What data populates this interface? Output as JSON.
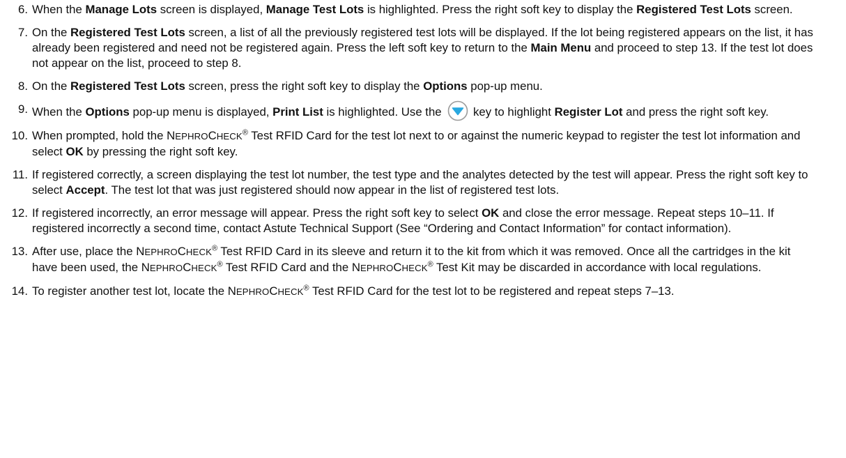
{
  "steps": [
    {
      "number": "6.",
      "parts": [
        {
          "t": "When the "
        },
        {
          "t": "Manage Lots",
          "b": true
        },
        {
          "t": " screen is displayed, "
        },
        {
          "t": "Manage Test Lots",
          "b": true
        },
        {
          "t": " is highlighted. Press the right soft key to display the "
        },
        {
          "t": "Registered Test Lots",
          "b": true
        },
        {
          "t": " screen."
        }
      ]
    },
    {
      "number": "7.",
      "parts": [
        {
          "t": "On the "
        },
        {
          "t": "Registered Test Lots",
          "b": true
        },
        {
          "t": " screen, a list of all the previously registered test lots will be displayed. If the lot being registered appears on the list, it has already been registered and need not be registered again. Press the left soft key to return to the "
        },
        {
          "t": "Main Menu",
          "b": true
        },
        {
          "t": " and proceed to step 13. If the test lot does not appear on the list, proceed to step 8."
        }
      ]
    },
    {
      "number": "8.",
      "parts": [
        {
          "t": "On the "
        },
        {
          "t": "Registered Test Lots",
          "b": true
        },
        {
          "t": " screen, press the right soft key to display the "
        },
        {
          "t": "Options",
          "b": true
        },
        {
          "t": " pop-up menu."
        }
      ]
    },
    {
      "number": "9.",
      "parts": [
        {
          "t": "When the "
        },
        {
          "t": "Options",
          "b": true
        },
        {
          "t": " pop-up menu is displayed, "
        },
        {
          "t": "Print List",
          "b": true
        },
        {
          "t": " is highlighted. Use the "
        },
        {
          "icon": "down-arrow-key-icon"
        },
        {
          "t": " key to highlight "
        },
        {
          "t": "Register Lot",
          "b": true
        },
        {
          "t": " and press the right soft key."
        }
      ]
    },
    {
      "number": "10.",
      "parts": [
        {
          "t": "When prompted, hold the "
        },
        {
          "t": "N"
        },
        {
          "t": "EPHRO",
          "sc": true
        },
        {
          "t": "C"
        },
        {
          "t": "HECK",
          "sc": true
        },
        {
          "t": "®",
          "sup": true
        },
        {
          "t": " Test RFID Card for the test lot next to or against the numeric keypad to register the test lot information and select "
        },
        {
          "t": "OK",
          "b": true
        },
        {
          "t": " by pressing the right soft key."
        }
      ]
    },
    {
      "number": "11.",
      "parts": [
        {
          "t": "If registered correctly, a screen displaying the test lot number, the test type and the analytes detected by the test will appear. Press the right soft key to select "
        },
        {
          "t": "Accept",
          "b": true
        },
        {
          "t": ". The test lot that was just registered should now appear in the list of registered test lots."
        }
      ]
    },
    {
      "number": "12.",
      "parts": [
        {
          "t": "If registered incorrectly, an error message will appear. Press the right soft key to select "
        },
        {
          "t": "OK",
          "b": true
        },
        {
          "t": " and close the error message. Repeat steps 10–11. If registered incorrectly a second time, contact Astute Technical Support (See “Ordering and Contact Information” for contact information)."
        }
      ]
    },
    {
      "number": "13.",
      "parts": [
        {
          "t": "After use, place the "
        },
        {
          "t": "N"
        },
        {
          "t": "EPHRO",
          "sc": true
        },
        {
          "t": "C"
        },
        {
          "t": "HECK",
          "sc": true
        },
        {
          "t": "®",
          "sup": true
        },
        {
          "t": " Test RFID Card in its sleeve and return it to the kit from which it was removed. Once all the cartridges in the kit have been used, the "
        },
        {
          "t": "N"
        },
        {
          "t": "EPHRO",
          "sc": true
        },
        {
          "t": "C"
        },
        {
          "t": "HECK",
          "sc": true
        },
        {
          "t": "®",
          "sup": true
        },
        {
          "t": " Test RFID Card and the "
        },
        {
          "t": "N"
        },
        {
          "t": "EPHRO",
          "sc": true
        },
        {
          "t": "C"
        },
        {
          "t": "HECK",
          "sc": true
        },
        {
          "t": "®",
          "sup": true
        },
        {
          "t": " Test Kit may be discarded in accordance with local regulations."
        }
      ]
    },
    {
      "number": "14.",
      "parts": [
        {
          "t": "To register another test lot, locate the "
        },
        {
          "t": "N"
        },
        {
          "t": "EPHRO",
          "sc": true
        },
        {
          "t": "C"
        },
        {
          "t": "HECK",
          "sc": true
        },
        {
          "t": "®",
          "sup": true
        },
        {
          "t": " Test RFID Card for the test lot to be registered and repeat steps 7–13."
        }
      ]
    }
  ],
  "colors": {
    "text": "#111111",
    "icon_fill": "#29a8e0",
    "icon_ring": "#9a9a9a"
  }
}
